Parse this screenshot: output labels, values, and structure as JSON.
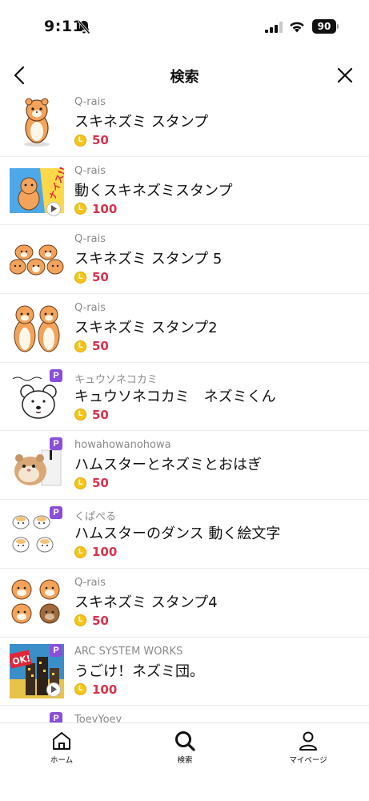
{
  "status_bar": {
    "time": "9:11",
    "battery": "90"
  },
  "header": {
    "title": "検索"
  },
  "results": [
    {
      "author": "Q-rais",
      "name": "スキネズミ スタンプ",
      "price": "50",
      "premium": false,
      "animated": false,
      "thumb": "hamster-single"
    },
    {
      "author": "Q-rais",
      "name": "動くスキネズミスタンプ",
      "price": "100",
      "premium": false,
      "animated": true,
      "thumb": "hamster-nice",
      "thumb_text": "ナイス!!"
    },
    {
      "author": "Q-rais",
      "name": "スキネズミ スタンプ 5",
      "price": "50",
      "premium": false,
      "animated": false,
      "thumb": "hamster-group"
    },
    {
      "author": "Q-rais",
      "name": "スキネズミ スタンプ2",
      "price": "50",
      "premium": false,
      "animated": false,
      "thumb": "hamster-pair"
    },
    {
      "author": "キュウソネコカミ",
      "name": "キュウソネコカミ　ネズミくん",
      "price": "50",
      "premium": true,
      "animated": false,
      "thumb": "mouse-drawing"
    },
    {
      "author": "howahowanohowa",
      "name": "ハムスターとネズミとおはぎ",
      "price": "50",
      "premium": true,
      "animated": false,
      "thumb": "hamster-photo"
    },
    {
      "author": "くぱぺる",
      "name": "ハムスターのダンス 動く絵文字",
      "price": "100",
      "premium": true,
      "animated": false,
      "thumb": "hamster-emoji"
    },
    {
      "author": "Q-rais",
      "name": "スキネズミ スタンプ4",
      "price": "50",
      "premium": false,
      "animated": false,
      "thumb": "hamster-faces"
    },
    {
      "author": "ARC SYSTEM WORKS",
      "name": "うごけ！ネズミ団。",
      "price": "100",
      "premium": true,
      "animated": true,
      "thumb": "pixel-city",
      "thumb_text": "OK!"
    },
    {
      "author": "ToeyYoey",
      "name": "",
      "price": "",
      "premium": true,
      "animated": false,
      "thumb": "partial"
    }
  ],
  "tabs": [
    {
      "label": "ホーム",
      "icon": "home-icon"
    },
    {
      "label": "検索",
      "icon": "search-icon"
    },
    {
      "label": "マイページ",
      "icon": "person-icon"
    }
  ],
  "colors": {
    "price": "#d9324d",
    "coin": "#f5c518",
    "premium": "#8a4fd8",
    "hamster": "#f3a35a"
  }
}
